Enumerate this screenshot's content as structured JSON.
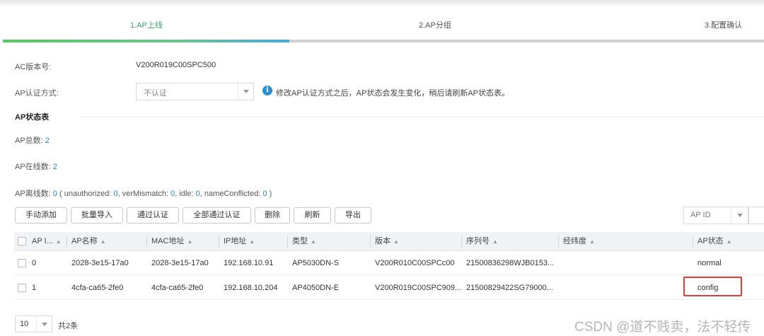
{
  "wizard": {
    "steps": [
      "1.AP上线",
      "2.AP分组",
      "3.配置确认"
    ],
    "active_step": 1,
    "progress_fraction": 0.375
  },
  "form": {
    "ac_version_label": "AC版本号:",
    "ac_version_value": "V200R019C00SPC500",
    "auth_label": "AP认证方式:",
    "auth_value": "不认证",
    "auth_hint": "修改AP认证方式之后，AP状态会发生变化，稍后请刷新AP状态表。",
    "info_icon": "info-icon"
  },
  "ap_status": {
    "section_title": "AP状态表",
    "total_label": "AP总数:",
    "total_value": "2",
    "online_label": "AP在线数:",
    "online_value": "2",
    "offline_label": "AP离线数:",
    "offline_value": "0",
    "unauthorized_label": "unauthorized:",
    "unauthorized_value": "0",
    "vermismatch_label": "verMismatch:",
    "vermismatch_value": "0",
    "idle_label": "idle:",
    "idle_value": "0",
    "nameconflicted_label": "nameConflicted:",
    "nameconflicted_value": "0"
  },
  "toolbar": {
    "buttons": [
      "手动添加",
      "批量导入",
      "通过认证",
      "全部通过认证",
      "删除",
      "刷新",
      "导出"
    ],
    "search_field": "AP ID"
  },
  "table": {
    "columns": [
      "AP I...",
      "AP名称",
      "MAC地址",
      "IP地址",
      "类型",
      "版本",
      "序列号",
      "经纬度",
      "AP状态"
    ],
    "rows": [
      {
        "id": "0",
        "name": "2028-3e15-17a0",
        "mac": "2028-3e15-17a0",
        "ip": "192.168.10.91",
        "type": "AP5030DN-S",
        "version": "V200R010C00SPCc00",
        "serial": "21500836298WJB0153...",
        "geo": "",
        "status": "normal"
      },
      {
        "id": "1",
        "name": "4cfa-ca65-2fe0",
        "mac": "4cfa-ca65-2fe0",
        "ip": "192.168.10.204",
        "type": "AP4050DN-E",
        "version": "V200R019C00SPC909...",
        "serial": "21500829422SG79000...",
        "geo": "",
        "status": "config"
      }
    ],
    "highlight_color": "#e53935"
  },
  "pagination": {
    "page_size": "10",
    "total_text": "共2条"
  },
  "watermark": "CSDN @道不贱卖，法不轻传",
  "colors": {
    "accent_green": "#3aa76d",
    "accent_blue": "#1e88c7"
  }
}
